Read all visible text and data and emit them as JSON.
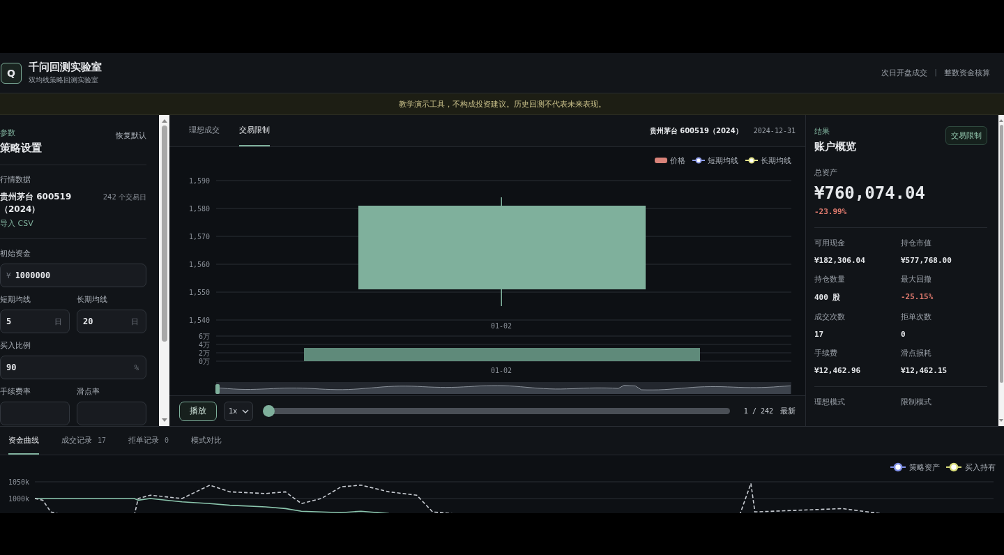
{
  "header": {
    "logo": "Q",
    "title": "千问回测实验室",
    "subtitle": "双均线策略回测实验室",
    "options": [
      "次日开盘成交",
      "整数资金核算"
    ],
    "separator": "|"
  },
  "notice": "教学演示工具，不构成投资建议。历史回测不代表未来表现。",
  "settings": {
    "eyebrow": "参数",
    "title": "策略设置",
    "reset": "恢复默认",
    "data_label": "行情数据",
    "dataset": "贵州茅台 600519（2024）",
    "day_count": "242",
    "day_unit": "个交易日",
    "import": "导入 CSV",
    "rows": [
      [
        {
          "label": "初始资金",
          "prefix": "¥",
          "value": "1000000"
        }
      ],
      [
        {
          "label": "短期均线",
          "value": "5",
          "suffix": "日"
        },
        {
          "label": "长期均线",
          "value": "20",
          "suffix": "日"
        }
      ],
      [
        {
          "label": "买入比例",
          "value": "90",
          "suffix": "%"
        }
      ],
      [
        {
          "label": "手续费率"
        },
        {
          "label": "滑点率"
        }
      ]
    ]
  },
  "center": {
    "tabs": [
      {
        "label": "理想成交",
        "selected": false
      },
      {
        "label": "交易限制",
        "selected": true
      }
    ],
    "instrument": "贵州茅台 600519（2024）",
    "date": "2024-12-31",
    "price_chart": {
      "legend": [
        {
          "name": "价格",
          "kind": "swatch",
          "color": "#d9837a"
        },
        {
          "name": "短期均线",
          "kind": "line",
          "color": "#8d9be8"
        },
        {
          "name": "长期均线",
          "kind": "line",
          "color": "#e3e38a"
        }
      ],
      "y_labels": [
        "1,590",
        "1,580",
        "1,570",
        "1,560",
        "1,550",
        "1,540"
      ],
      "x_label": "01-02"
    },
    "volume_chart": {
      "y_labels": [
        "6万",
        "4万",
        "2万",
        "0万"
      ],
      "x_label": "01-02"
    },
    "controls": {
      "play": "播放",
      "speed": "1x",
      "level": 0,
      "position": "1 / 242",
      "latest": "最新"
    }
  },
  "results": {
    "eyebrow": "结果",
    "badge": "交易限制",
    "title": "账户概览",
    "total_label": "总资产",
    "total": "¥760,074.04",
    "change": "-23.99%",
    "change_negative": true,
    "stats": [
      {
        "label": "可用现金",
        "value": "¥182,306.04",
        "negative": false
      },
      {
        "label": "持仓市值",
        "value": "¥577,768.00",
        "negative": false
      },
      {
        "label": "持仓数量",
        "value": "400 股",
        "negative": false
      },
      {
        "label": "最大回撤",
        "value": "-25.15%",
        "negative": true
      },
      {
        "label": "成交次数",
        "value": "17",
        "negative": false
      },
      {
        "label": "拒单次数",
        "value": "0",
        "negative": false
      },
      {
        "label": "手续费",
        "value": "¥12,462.96",
        "negative": false
      },
      {
        "label": "滑点损耗",
        "value": "¥12,462.15",
        "negative": false
      }
    ],
    "modes": [
      "理想模式",
      "限制模式"
    ]
  },
  "bottom": {
    "tabs": [
      {
        "label": "资金曲线",
        "selected": true
      },
      {
        "label": "成交记录",
        "count": "17",
        "selected": false
      },
      {
        "label": "拒单记录",
        "count": "0",
        "selected": false
      },
      {
        "label": "模式对比",
        "selected": false
      }
    ],
    "equity_chart": {
      "legend": [
        {
          "name": "策略资产",
          "color": "#7f8fe6"
        },
        {
          "name": "买入持有",
          "color": "#d8dc7a"
        }
      ],
      "y_labels": [
        "1050k",
        "1000k"
      ]
    }
  }
}
